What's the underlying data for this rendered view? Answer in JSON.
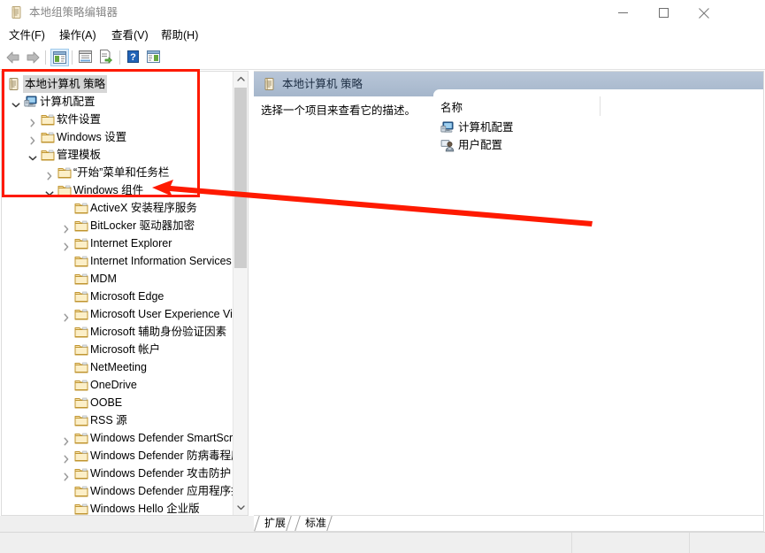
{
  "window": {
    "title": "本地组策略编辑器",
    "icon": "policy-scroll-icon",
    "buttons": {
      "minimize": "—",
      "maximize": "☐",
      "close": "✕"
    }
  },
  "menubar": {
    "items": [
      {
        "label": "文件(F)",
        "name": "menu-file"
      },
      {
        "label": "操作(A)",
        "name": "menu-action"
      },
      {
        "label": "查看(V)",
        "name": "menu-view"
      },
      {
        "label": "帮助(H)",
        "name": "menu-help"
      }
    ]
  },
  "toolbar": {
    "items": [
      {
        "name": "back-arrow-icon",
        "selected": false
      },
      {
        "name": "forward-arrow-icon",
        "selected": false
      },
      {
        "name": "show-hide-tree-icon",
        "selected": true
      },
      {
        "name": "properties-icon",
        "selected": false
      },
      {
        "name": "export-list-icon",
        "selected": false
      },
      {
        "name": "help-icon",
        "selected": false
      },
      {
        "name": "show-action-pane-icon",
        "selected": false
      }
    ]
  },
  "tree": {
    "nodes": [
      {
        "label": "本地计算机 策略",
        "indent": 0,
        "icon": "policy-scroll-icon",
        "chevron": "none",
        "selected": true
      },
      {
        "label": "计算机配置",
        "indent": 1,
        "icon": "computer-icon",
        "chevron": "down",
        "selected": false
      },
      {
        "label": "软件设置",
        "indent": 2,
        "icon": "folder-icon",
        "chevron": "right",
        "selected": false
      },
      {
        "label": "Windows 设置",
        "indent": 2,
        "icon": "folder-icon",
        "chevron": "right",
        "selected": false
      },
      {
        "label": "管理模板",
        "indent": 2,
        "icon": "folder-icon",
        "chevron": "down",
        "selected": false
      },
      {
        "label": "“开始”菜单和任务栏",
        "indent": 3,
        "icon": "folder-icon",
        "chevron": "right",
        "selected": false
      },
      {
        "label": "Windows 组件",
        "indent": 3,
        "icon": "folder-icon",
        "chevron": "down",
        "selected": false
      },
      {
        "label": "ActiveX 安装程序服务",
        "indent": 4,
        "icon": "folder-icon",
        "chevron": "none",
        "selected": false
      },
      {
        "label": "BitLocker 驱动器加密",
        "indent": 4,
        "icon": "folder-icon",
        "chevron": "right",
        "selected": false
      },
      {
        "label": "Internet Explorer",
        "indent": 4,
        "icon": "folder-icon",
        "chevron": "right",
        "selected": false
      },
      {
        "label": "Internet Information Services",
        "indent": 4,
        "icon": "folder-icon",
        "chevron": "none",
        "selected": false
      },
      {
        "label": "MDM",
        "indent": 4,
        "icon": "folder-icon",
        "chevron": "none",
        "selected": false
      },
      {
        "label": "Microsoft Edge",
        "indent": 4,
        "icon": "folder-icon",
        "chevron": "none",
        "selected": false
      },
      {
        "label": "Microsoft User Experience Virtualization",
        "indent": 4,
        "icon": "folder-icon",
        "chevron": "right",
        "selected": false
      },
      {
        "label": "Microsoft 辅助身份验证因素",
        "indent": 4,
        "icon": "folder-icon",
        "chevron": "none",
        "selected": false
      },
      {
        "label": "Microsoft 帐户",
        "indent": 4,
        "icon": "folder-icon",
        "chevron": "none",
        "selected": false
      },
      {
        "label": "NetMeeting",
        "indent": 4,
        "icon": "folder-icon",
        "chevron": "none",
        "selected": false
      },
      {
        "label": "OneDrive",
        "indent": 4,
        "icon": "folder-icon",
        "chevron": "none",
        "selected": false
      },
      {
        "label": "OOBE",
        "indent": 4,
        "icon": "folder-icon",
        "chevron": "none",
        "selected": false
      },
      {
        "label": "RSS 源",
        "indent": 4,
        "icon": "folder-icon",
        "chevron": "none",
        "selected": false
      },
      {
        "label": "Windows Defender SmartScreen",
        "indent": 4,
        "icon": "folder-icon",
        "chevron": "right",
        "selected": false
      },
      {
        "label": "Windows Defender 防病毒程序",
        "indent": 4,
        "icon": "folder-icon",
        "chevron": "right",
        "selected": false
      },
      {
        "label": "Windows Defender 攻击防护",
        "indent": 4,
        "icon": "folder-icon",
        "chevron": "right",
        "selected": false
      },
      {
        "label": "Windows Defender 应用程序控制",
        "indent": 4,
        "icon": "folder-icon",
        "chevron": "none",
        "selected": false
      },
      {
        "label": "Windows Hello 企业版",
        "indent": 4,
        "icon": "folder-icon",
        "chevron": "none",
        "selected": false
      }
    ]
  },
  "rightpane": {
    "header": {
      "title": "本地计算机 策略",
      "icon": "policy-scroll-icon"
    },
    "description": "选择一个项目来查看它的描述。",
    "column_header": "名称",
    "items": [
      {
        "label": "计算机配置",
        "icon": "computer-icon"
      },
      {
        "label": "用户配置",
        "icon": "user-icon"
      }
    ]
  },
  "tabs": [
    {
      "label": "扩展",
      "active": false,
      "name": "tab-extended"
    },
    {
      "label": "标准",
      "active": true,
      "name": "tab-standard"
    }
  ],
  "annotation": {
    "box_color": "#fe1a00",
    "arrow_color": "#fe1a00",
    "arrow_from": "670,253",
    "arrow_to": "172,212"
  }
}
